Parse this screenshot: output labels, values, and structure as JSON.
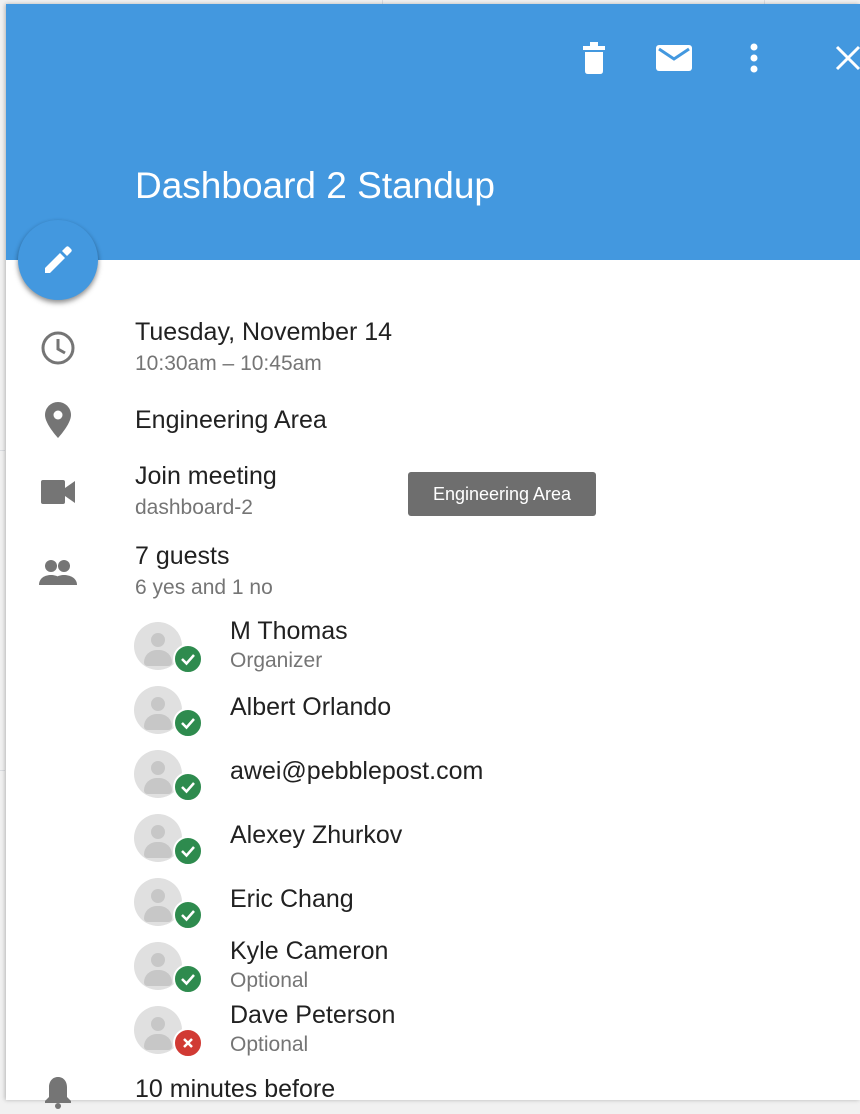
{
  "header": {
    "title": "Dashboard 2 Standup",
    "color": "#4398df",
    "actions": [
      {
        "icon": "trash-icon",
        "label": "delete"
      },
      {
        "icon": "mail-icon",
        "label": "email"
      },
      {
        "icon": "more-vert-icon",
        "label": "more options"
      },
      {
        "icon": "close-icon",
        "label": "close"
      }
    ]
  },
  "fab": {
    "icon": "edit-pencil-icon"
  },
  "event": {
    "date": "Tuesday, November 14",
    "time": "10:30am – 10:45am",
    "location": "Engineering Area",
    "meeting_label": "Join meeting",
    "meeting_id": "dashboard-2",
    "tooltip": "Engineering Area"
  },
  "guests": {
    "count_label": "7 guests",
    "summary": "6 yes and 1 no",
    "list": [
      {
        "name": "M Thomas",
        "role": "Organizer",
        "status": "yes"
      },
      {
        "name": "Albert Orlando",
        "role": "",
        "status": "yes"
      },
      {
        "name": "awei@pebblepost.com",
        "role": "",
        "status": "yes"
      },
      {
        "name": "Alexey Zhurkov",
        "role": "",
        "status": "yes"
      },
      {
        "name": "Eric Chang",
        "role": "",
        "status": "yes"
      },
      {
        "name": "Kyle Cameron",
        "role": "Optional",
        "status": "yes"
      },
      {
        "name": "Dave Peterson",
        "role": "Optional",
        "status": "no"
      }
    ]
  },
  "reminder": {
    "label": "10 minutes before"
  },
  "colors": {
    "yes": "#2e8b4e",
    "no": "#d13a34",
    "icon_gray": "#757575"
  }
}
